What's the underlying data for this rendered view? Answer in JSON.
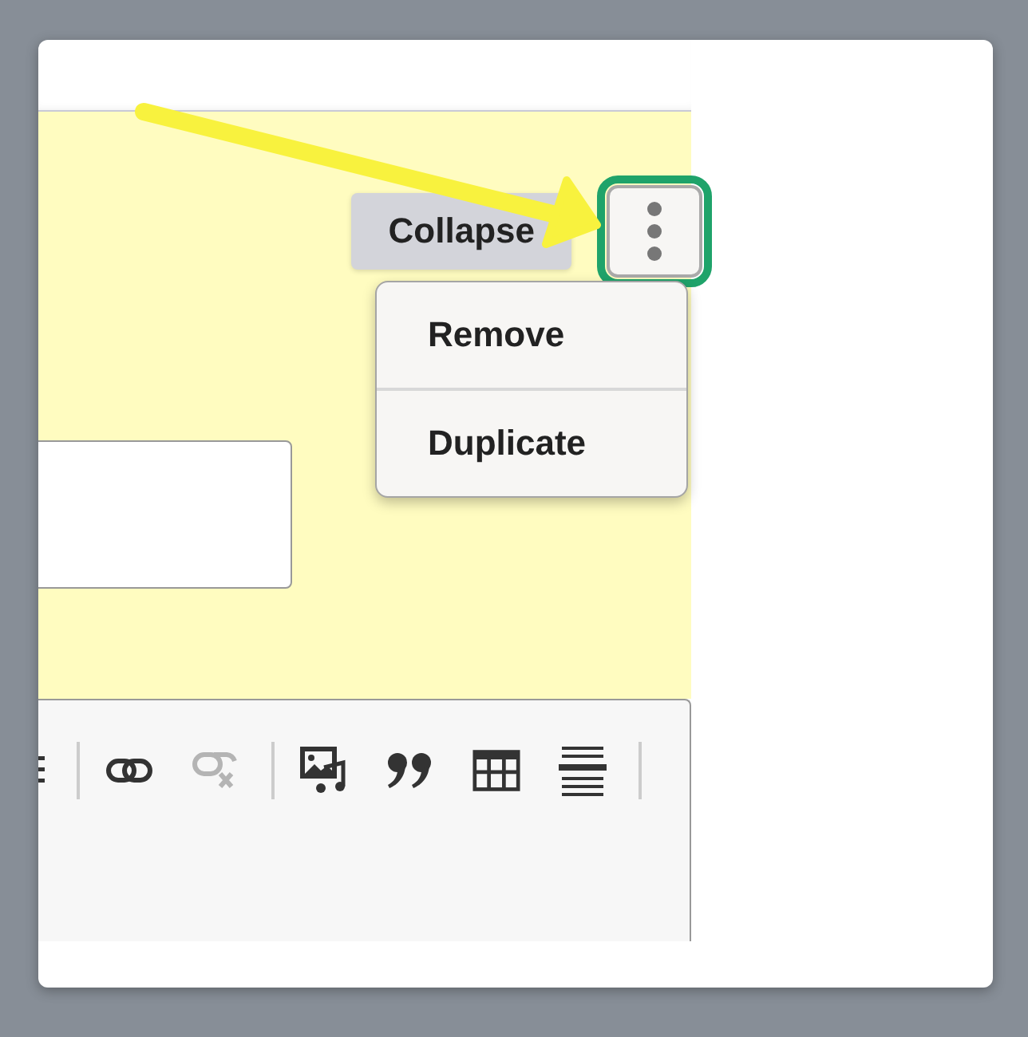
{
  "block": {
    "collapse_button": "Collapse",
    "menu_button": {
      "expanded": true,
      "highlighted": true
    },
    "menu": {
      "items": [
        {
          "label": "Remove"
        },
        {
          "label": "Duplicate"
        }
      ]
    }
  },
  "toolbar": {
    "groups": [
      [
        {
          "disabled": false
        }
      ],
      [
        {
          "disabled": false
        },
        {
          "disabled": true
        }
      ],
      [
        {
          "disabled": false
        },
        {
          "disabled": false
        },
        {
          "disabled": false
        },
        {
          "disabled": false
        }
      ]
    ]
  },
  "annotation": {
    "arrow": true
  }
}
